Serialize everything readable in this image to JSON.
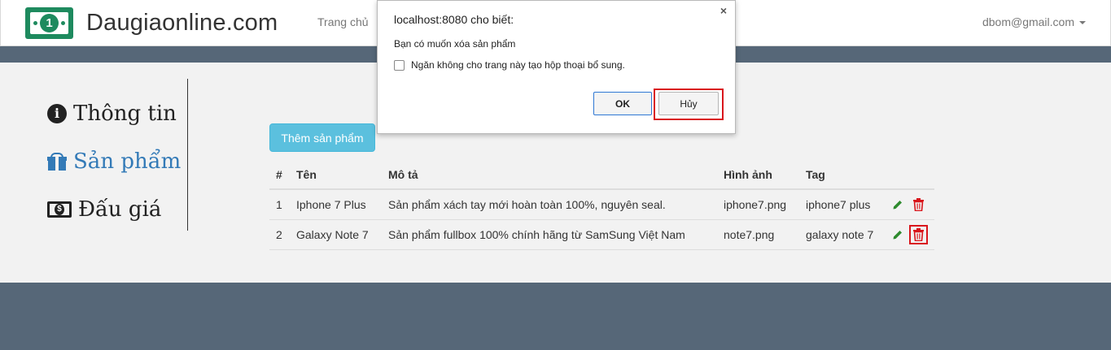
{
  "navbar": {
    "brand": "Daugiaonline.com",
    "logo_symbol": "1",
    "home": "Trang chủ",
    "user": "dbom@gmail.com"
  },
  "sidebar": {
    "items": [
      {
        "label": "Thông tin",
        "icon": "info-circle-icon"
      },
      {
        "label": "Sản phẩm",
        "icon": "gift-icon",
        "active": true
      },
      {
        "label": "Đấu giá",
        "icon": "money-icon"
      }
    ]
  },
  "products": {
    "add_label": "Thêm sản phẩm",
    "columns": [
      "#",
      "Tên",
      "Mô tả",
      "Hình ảnh",
      "Tag"
    ],
    "rows": [
      {
        "num": "1",
        "name": "Iphone 7 Plus",
        "desc": "Sản phẩm xách tay mới hoàn toàn 100%, nguyên seal.",
        "image": "iphone7.png",
        "tag": "iphone7 plus"
      },
      {
        "num": "2",
        "name": "Galaxy Note 7",
        "desc": "Sản phẩm fullbox 100% chính hãng từ SamSung Việt Nam",
        "image": "note7.png",
        "tag": "galaxy note 7"
      }
    ]
  },
  "dialog": {
    "title": "localhost:8080 cho biết:",
    "close": "×",
    "message": "Bạn có muốn xóa sản phẩm",
    "checkbox_label": "Ngăn không cho trang này tạo hộp thoại bổ sung.",
    "ok_label": "OK",
    "cancel_label": "Hủy"
  },
  "colors": {
    "brand_green": "#1e8a5e",
    "header_band": "#566778",
    "info_button": "#5bc0de",
    "active_link": "#337ab7",
    "edit_icon": "#2e8b2e",
    "delete_icon": "#d9161c",
    "highlight": "#d9161c"
  }
}
